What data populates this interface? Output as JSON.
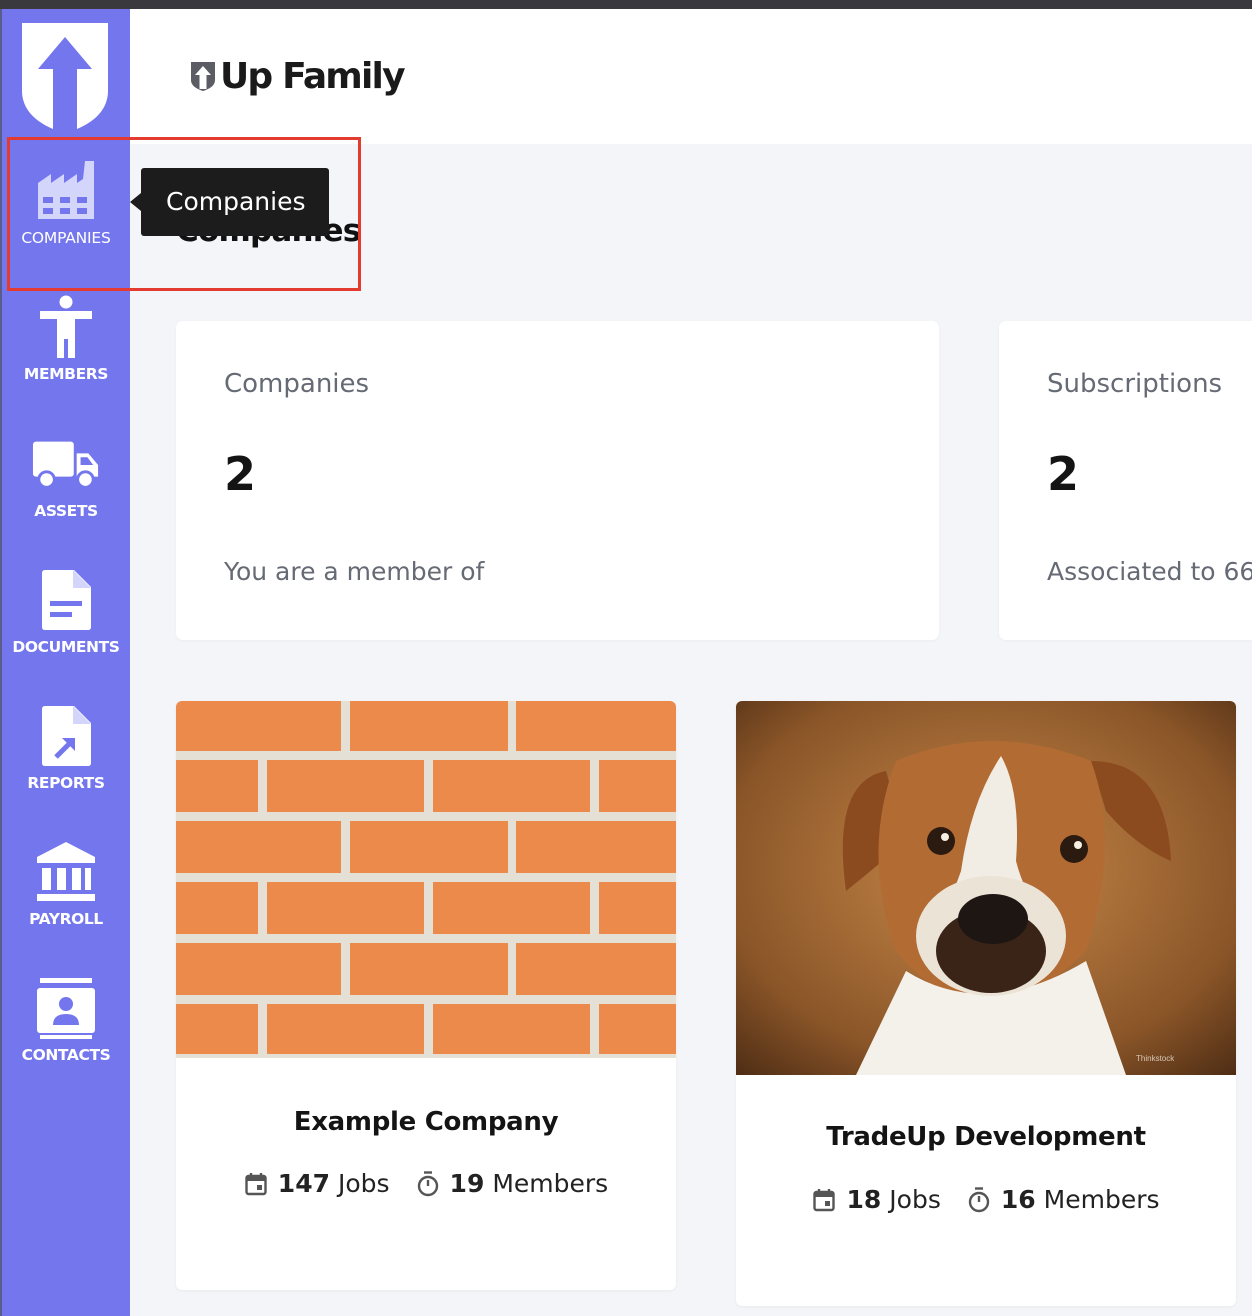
{
  "app": {
    "brand_name": "Up Family",
    "accent_color": "#7476ee"
  },
  "sidebar": {
    "items": [
      {
        "label": "COMPANIES",
        "icon": "factory-icon",
        "active": true
      },
      {
        "label": "MEMBERS",
        "icon": "person-icon"
      },
      {
        "label": "ASSETS",
        "icon": "truck-icon"
      },
      {
        "label": "DOCUMENTS",
        "icon": "document-icon"
      },
      {
        "label": "REPORTS",
        "icon": "report-icon"
      },
      {
        "label": "PAYROLL",
        "icon": "bank-icon"
      },
      {
        "label": "CONTACTS",
        "icon": "contact-card-icon"
      }
    ]
  },
  "tooltip": {
    "text": "Companies"
  },
  "page": {
    "title": "Companies"
  },
  "stats": [
    {
      "title": "Companies",
      "value": "2",
      "subtitle": "You are a member of"
    },
    {
      "title": "Subscriptions",
      "value": "2",
      "subtitle": "Associated to 66"
    }
  ],
  "companies": [
    {
      "name": "Example Company",
      "jobs": "147",
      "jobs_label": "Jobs",
      "members": "19",
      "members_label": "Members",
      "image": "brick-wall"
    },
    {
      "name": "TradeUp Development",
      "jobs": "18",
      "jobs_label": "Jobs",
      "members": "16",
      "members_label": "Members",
      "image": "boxer-dog",
      "image_credit": "Thinkstock"
    }
  ]
}
